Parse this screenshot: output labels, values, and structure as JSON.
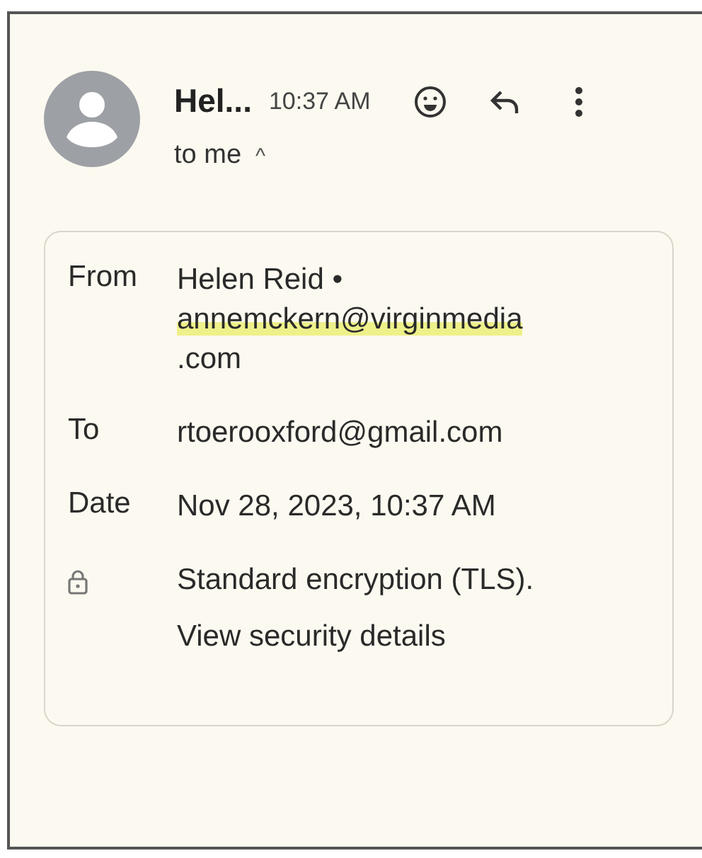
{
  "header": {
    "sender": "Hel...",
    "time": "10:37 AM",
    "recipient": "to me",
    "caret": "^"
  },
  "details": {
    "rows": [
      {
        "kind": "from",
        "label": "From",
        "name": "Helen Reid •",
        "email_lines": [
          "annemckern@virginmedia",
          ".com"
        ],
        "highlighted": true
      },
      {
        "kind": "text",
        "label": "To",
        "value": "rtoerooxford@gmail.com"
      },
      {
        "kind": "text",
        "label": "Date",
        "value": "Nov 28, 2023, 10:37 AM"
      },
      {
        "kind": "security",
        "value": "Standard encryption (TLS).",
        "link": "View security details"
      }
    ]
  }
}
